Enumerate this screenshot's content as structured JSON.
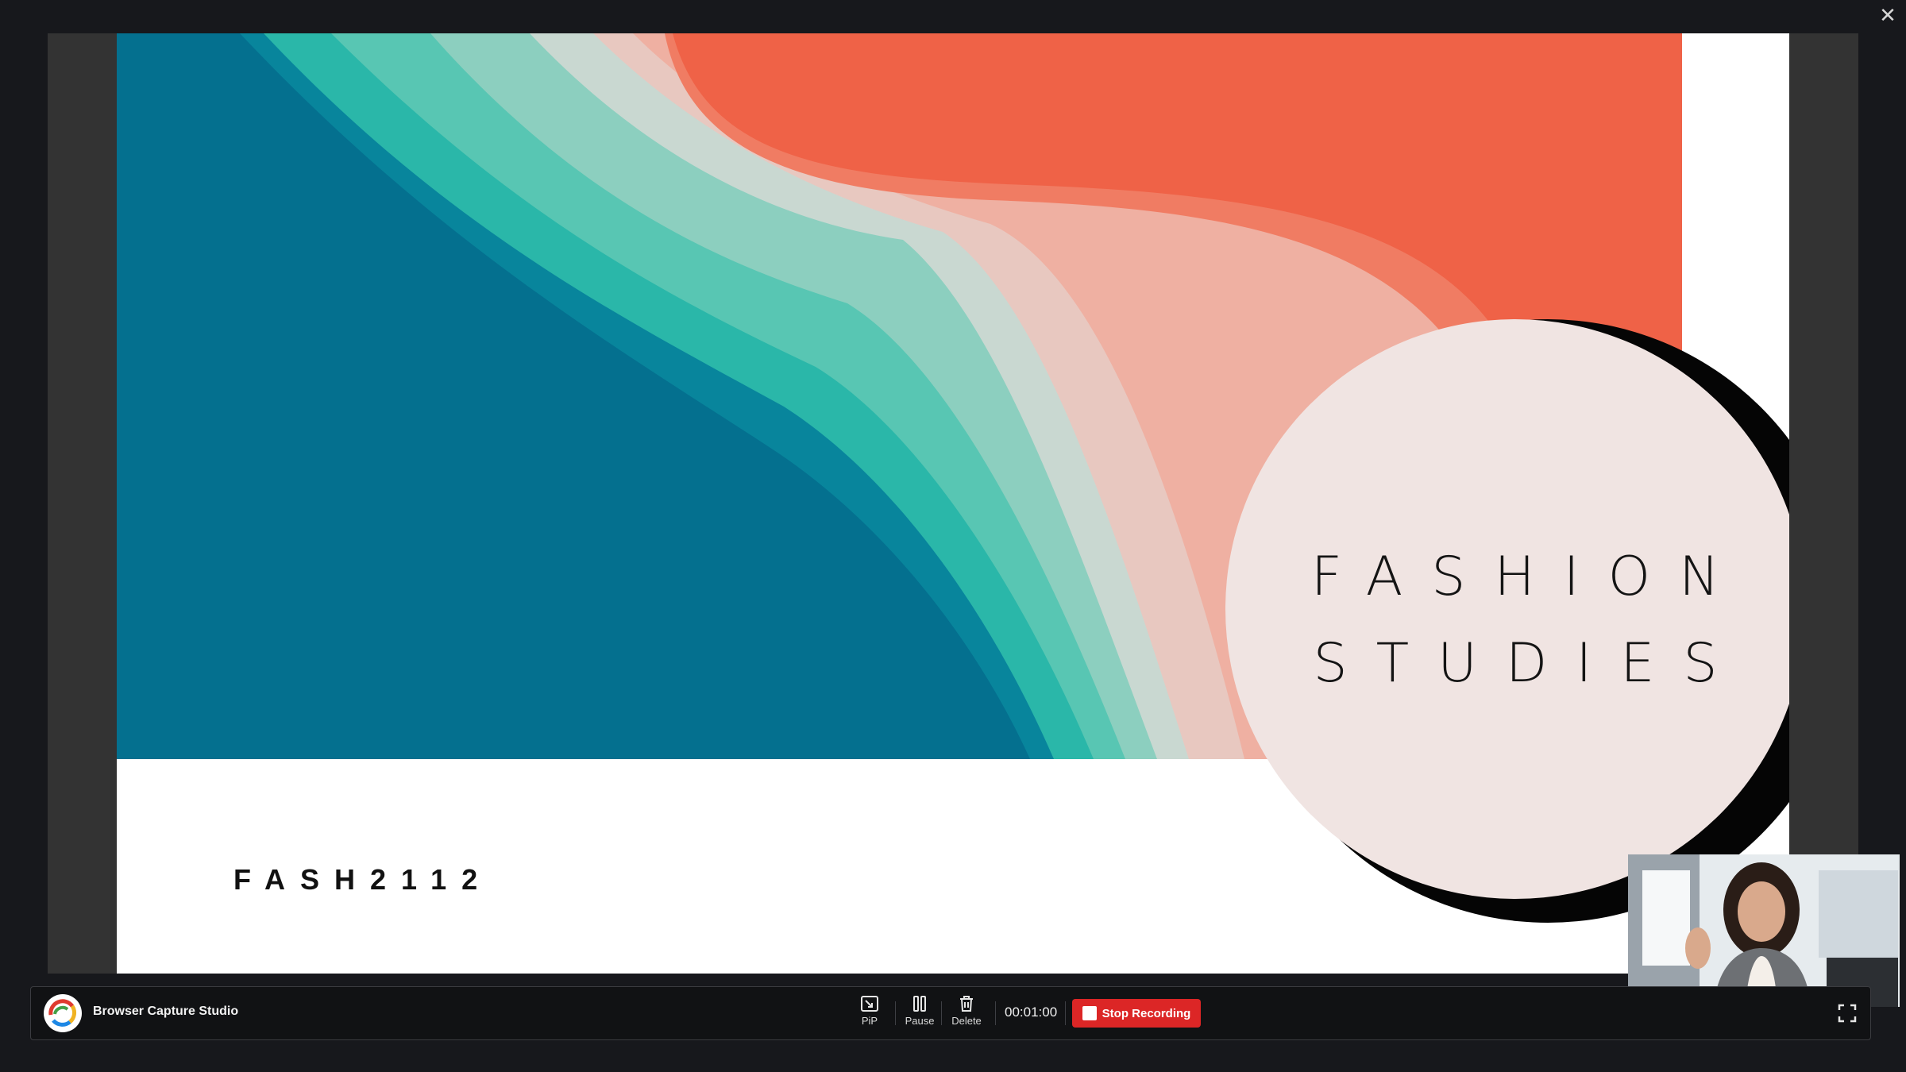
{
  "window": {
    "close_icon": "close-icon"
  },
  "slide": {
    "title_line1": "FASHION",
    "title_line2": "STUDIES",
    "course_code": "FASH2112",
    "menu_icon": "slide-menu-icon"
  },
  "toolbar": {
    "app_name": "Browser Capture Studio",
    "pip_label": "PiP",
    "pause_label": "Pause",
    "delete_label": "Delete",
    "timer": "00:01:00",
    "stop_label": "Stop Recording",
    "fullscreen_icon": "fullscreen-icon"
  },
  "colors": {
    "background": "#17181c",
    "stop_button": "#dc2626",
    "banner_teal": "#04708f",
    "banner_coral": "#ef6247",
    "circle_fill": "#f0e4e2"
  }
}
